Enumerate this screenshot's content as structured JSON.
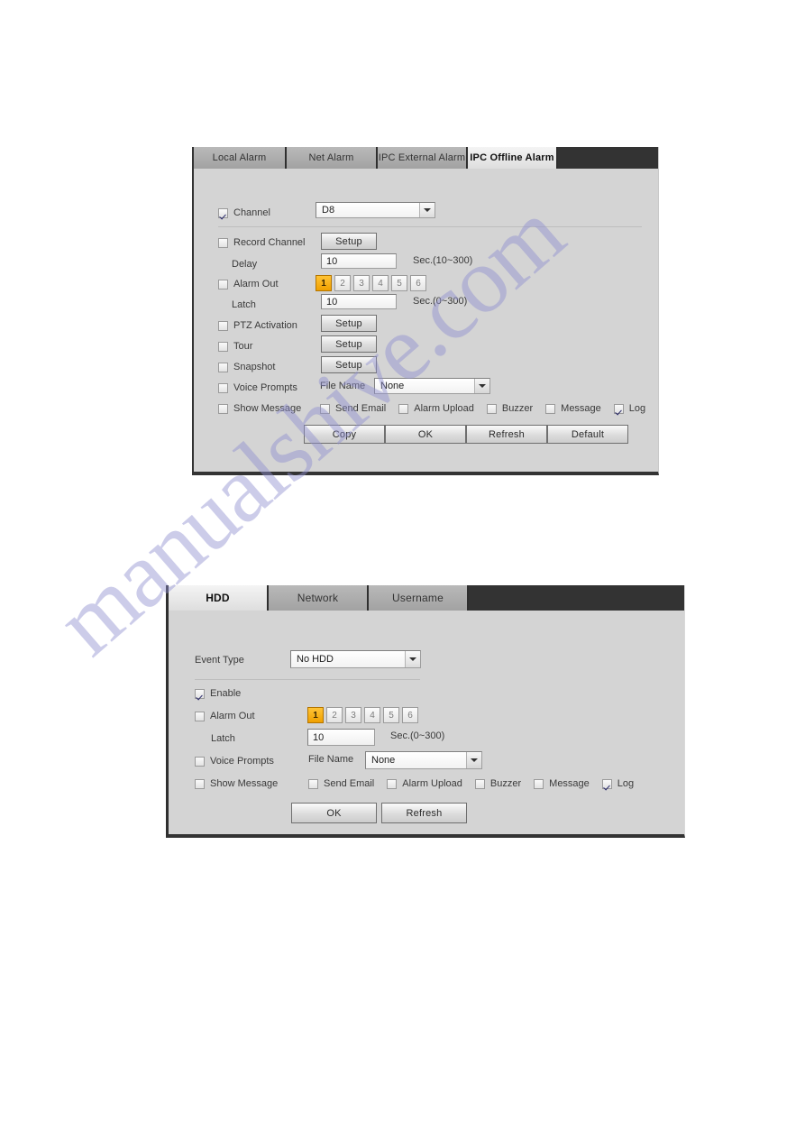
{
  "watermark": {
    "text": "manualshive.com"
  },
  "panel1": {
    "tabs": [
      {
        "label": "Local Alarm",
        "active": false
      },
      {
        "label": "Net Alarm",
        "active": false
      },
      {
        "label": "IPC External Alarm",
        "active": false
      },
      {
        "label": "IPC Offline Alarm",
        "active": true
      }
    ],
    "channel": {
      "label": "Channel",
      "checked": true,
      "value": "D8"
    },
    "record_channel": {
      "label": "Record Channel",
      "checked": false,
      "button": "Setup"
    },
    "delay": {
      "label": "Delay",
      "value": "10",
      "unit": "Sec.(10~300)"
    },
    "alarm_out": {
      "label": "Alarm Out",
      "checked": false,
      "options": [
        "1",
        "2",
        "3",
        "4",
        "5",
        "6"
      ],
      "selected": "1"
    },
    "latch": {
      "label": "Latch",
      "value": "10",
      "unit": "Sec.(0~300)"
    },
    "ptz_activation": {
      "label": "PTZ Activation",
      "checked": false,
      "button": "Setup"
    },
    "tour": {
      "label": "Tour",
      "checked": false,
      "button": "Setup"
    },
    "snapshot": {
      "label": "Snapshot",
      "checked": false,
      "button": "Setup"
    },
    "voice_prompts": {
      "label": "Voice Prompts",
      "checked": false,
      "file_label": "File Name",
      "file_value": "None"
    },
    "show_message": {
      "label": "Show Message",
      "checked": false
    },
    "notify": [
      {
        "label": "Send Email",
        "checked": false
      },
      {
        "label": "Alarm Upload",
        "checked": false
      },
      {
        "label": "Buzzer",
        "checked": false
      },
      {
        "label": "Message",
        "checked": false
      },
      {
        "label": "Log",
        "checked": true
      }
    ],
    "buttons": [
      {
        "label": "Copy"
      },
      {
        "label": "OK"
      },
      {
        "label": "Refresh"
      },
      {
        "label": "Default"
      }
    ]
  },
  "panel2": {
    "tabs": [
      {
        "label": "HDD",
        "active": true
      },
      {
        "label": "Network",
        "active": false
      },
      {
        "label": "Username",
        "active": false
      }
    ],
    "event_type": {
      "label": "Event Type",
      "value": "No HDD"
    },
    "enable": {
      "label": "Enable",
      "checked": true
    },
    "alarm_out": {
      "label": "Alarm Out",
      "checked": false,
      "options": [
        "1",
        "2",
        "3",
        "4",
        "5",
        "6"
      ],
      "selected": "1"
    },
    "latch": {
      "label": "Latch",
      "value": "10",
      "unit": "Sec.(0~300)"
    },
    "voice_prompts": {
      "label": "Voice Prompts",
      "checked": false,
      "file_label": "File Name",
      "file_value": "None"
    },
    "show_message": {
      "label": "Show Message",
      "checked": false
    },
    "notify": [
      {
        "label": "Send Email",
        "checked": false
      },
      {
        "label": "Alarm Upload",
        "checked": false
      },
      {
        "label": "Buzzer",
        "checked": false
      },
      {
        "label": "Message",
        "checked": false
      },
      {
        "label": "Log",
        "checked": true
      }
    ],
    "buttons": [
      {
        "label": "OK"
      },
      {
        "label": "Refresh"
      }
    ]
  },
  "colors": {
    "panel_bg": "#d4d4d4",
    "tab_strip": "#333333",
    "accent_orange": "#f0a000",
    "watermark": "#8f8fd0"
  }
}
